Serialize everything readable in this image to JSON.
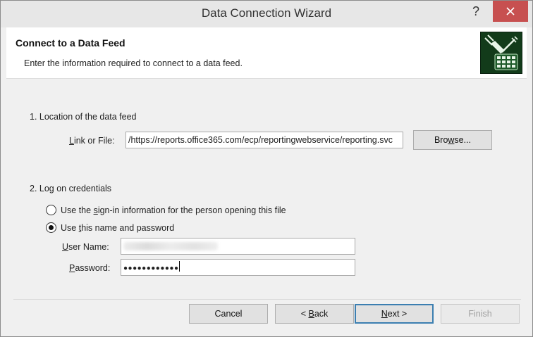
{
  "window": {
    "title": "Data Connection Wizard",
    "help_glyph": "?"
  },
  "header": {
    "title": "Connect to a Data Feed",
    "subtitle": "Enter the information required to connect to a data feed.",
    "logo_icon": "data-feed-plug-icon"
  },
  "location": {
    "section_label": "1. Location of the data feed",
    "link_label_key": "L",
    "link_label_rest": "ink or File:",
    "url_value": "https://reports.office365.com/ecp/reportingwebservice/reporting.svc/",
    "browse_key": "w",
    "browse_pre": "Bro",
    "browse_post": "se..."
  },
  "credentials": {
    "section_label": "2. Log on credentials",
    "option1_pre": "Use the ",
    "option1_key": "s",
    "option1_post": "ign-in information for the person opening this file",
    "option1_checked": false,
    "option2_pre": "Use ",
    "option2_key": "t",
    "option2_post": "his name and password",
    "option2_checked": true,
    "username_key": "U",
    "username_rest": "ser Name:",
    "username_value": "",
    "password_key": "P",
    "password_rest": "assword:",
    "password_mask": "●●●●●●●●●●●●"
  },
  "buttons": {
    "cancel": "Cancel",
    "back_pre": "< ",
    "back_key": "B",
    "back_post": "ack",
    "next_key": "N",
    "next_post": "ext >",
    "finish": "Finish"
  },
  "colors": {
    "close_button": "#c75050",
    "default_button_border": "#3c7fb1",
    "logo_background": "#123b1a"
  }
}
